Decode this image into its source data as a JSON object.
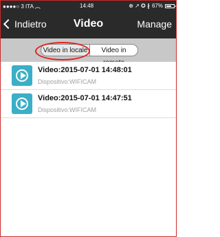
{
  "status_bar": {
    "carrier": "●●●●○ 3 ITA",
    "wifi_icon": "wifi-icon",
    "time": "14:48",
    "indicators": "⊕ ↗ ✪ ∦",
    "battery_percent": "67%"
  },
  "nav": {
    "back_label": "Indietro",
    "title": "Video",
    "manage_label": "Manage"
  },
  "segments": {
    "local_label": "Video in locale",
    "remote_label": "Video in remoto",
    "selected": "local"
  },
  "videos": [
    {
      "title": "Video:2015-07-01 14:48:01",
      "device": "Dispositivo:WIFICAM"
    },
    {
      "title": "Video:2015-07-01 14:47:51",
      "device": "Dispositivo:WIFICAM"
    }
  ],
  "colors": {
    "bar": "#2a2a2a",
    "segment_bg": "#c8c8c8",
    "play_icon": "#3bafc7",
    "highlight": "#e02020"
  }
}
